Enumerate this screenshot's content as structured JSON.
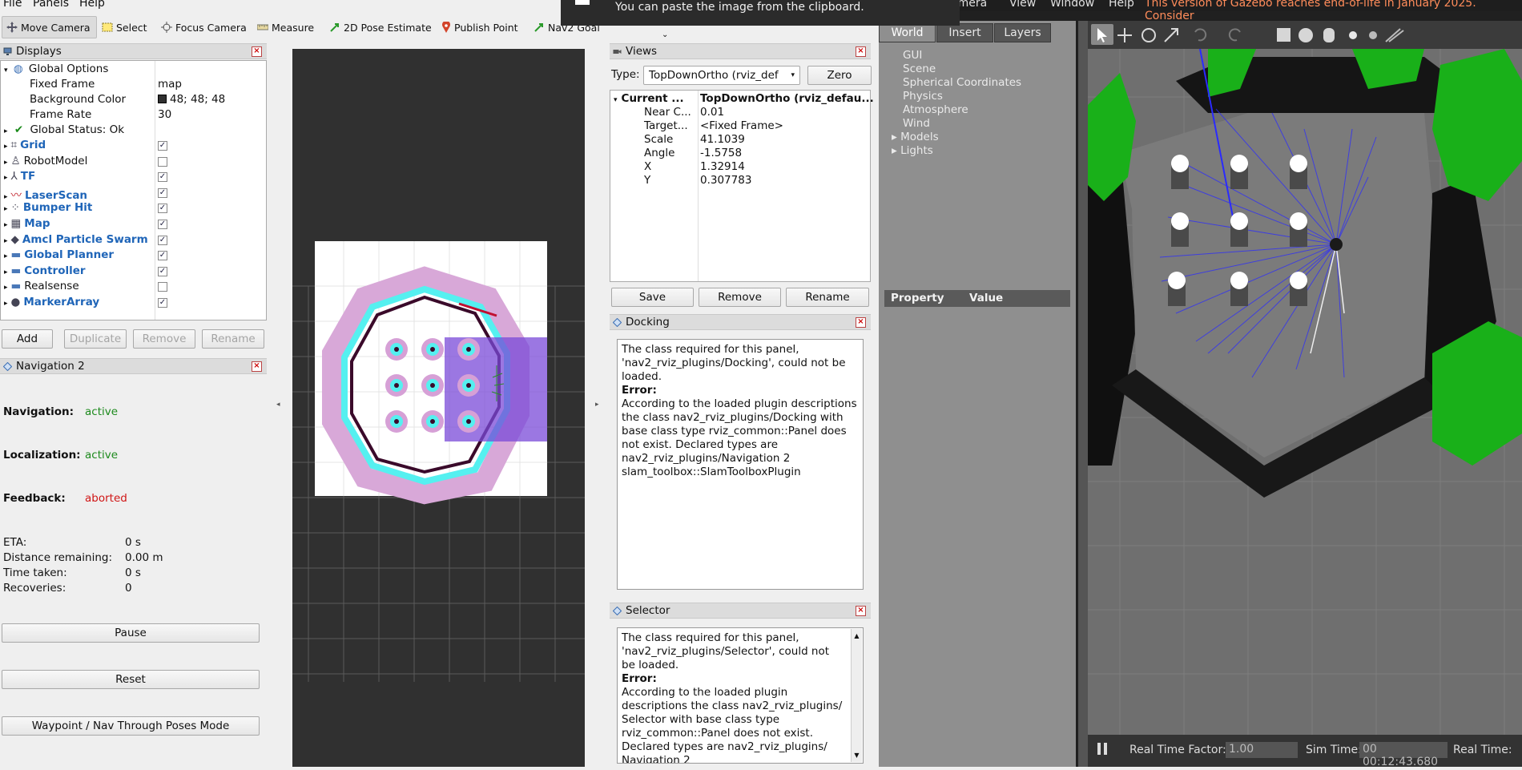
{
  "menubar": {
    "file": "File",
    "panels": "Panels",
    "help": "Help"
  },
  "toolbar": {
    "move_camera": "Move Camera",
    "select": "Select",
    "focus_camera": "Focus Camera",
    "measure": "Measure",
    "pose_estimate": "2D Pose Estimate",
    "publish_point": "Publish Point",
    "nav2_goal": "Nav2 Goal"
  },
  "notification": {
    "text": "You can paste the image from the clipboard."
  },
  "displays": {
    "title": "Displays",
    "global_options": "Global Options",
    "props": [
      {
        "name": "Fixed Frame",
        "value": "map"
      },
      {
        "name": "Background Color",
        "value": "48; 48; 48"
      },
      {
        "name": "Frame Rate",
        "value": "30"
      }
    ],
    "global_status": "Global Status: Ok",
    "items": [
      {
        "label": "Grid",
        "checked": true,
        "bold": true
      },
      {
        "label": "RobotModel",
        "checked": false,
        "bold": false
      },
      {
        "label": "TF",
        "checked": true,
        "bold": true
      },
      {
        "label": "LaserScan",
        "checked": true,
        "bold": true
      },
      {
        "label": "Bumper Hit",
        "checked": true,
        "bold": true
      },
      {
        "label": "Map",
        "checked": true,
        "bold": true
      },
      {
        "label": "Amcl Particle Swarm",
        "checked": true,
        "bold": true
      },
      {
        "label": "Global Planner",
        "checked": true,
        "bold": true
      },
      {
        "label": "Controller",
        "checked": true,
        "bold": true
      },
      {
        "label": "Realsense",
        "checked": false,
        "bold": false
      },
      {
        "label": "MarkerArray",
        "checked": true,
        "bold": true
      }
    ],
    "buttons": {
      "add": "Add",
      "duplicate": "Duplicate",
      "remove": "Remove",
      "rename": "Rename"
    }
  },
  "navigation": {
    "title": "Navigation 2",
    "navigation_label": "Navigation:",
    "navigation_value": "active",
    "localization_label": "Localization:",
    "localization_value": "active",
    "feedback_label": "Feedback:",
    "feedback_value": "aborted",
    "eta_label": "ETA:",
    "eta_value": "0 s",
    "distance_label": "Distance remaining:",
    "distance_value": "0.00 m",
    "time_label": "Time taken:",
    "time_value": "0 s",
    "recoveries_label": "Recoveries:",
    "recoveries_value": "0",
    "pause": "Pause",
    "reset": "Reset",
    "waypoint": "Waypoint / Nav Through Poses Mode"
  },
  "views": {
    "title": "Views",
    "type_label": "Type:",
    "type_value": "TopDownOrtho (rviz_def",
    "zero": "Zero",
    "current_label": "Current ...",
    "current_value": "TopDownOrtho (rviz_defau...",
    "props": [
      {
        "name": "Near C...",
        "value": "0.01"
      },
      {
        "name": "Target...",
        "value": "<Fixed Frame>"
      },
      {
        "name": "Scale",
        "value": "41.1039"
      },
      {
        "name": "Angle",
        "value": "-1.5758"
      },
      {
        "name": "X",
        "value": "1.32914"
      },
      {
        "name": "Y",
        "value": "0.307783"
      }
    ],
    "save": "Save",
    "remove": "Remove",
    "rename": "Rename"
  },
  "docking": {
    "title": "Docking",
    "line1": "The class required for this panel, 'nav2_rviz_plugins/Docking', could not be loaded.",
    "error_label": "Error:",
    "line2": "According to the loaded plugin descriptions the class nav2_rviz_plugins/Docking with base class type rviz_common::Panel does not exist. Declared types are nav2_rviz_plugins/Navigation 2 slam_toolbox::SlamToolboxPlugin"
  },
  "selector": {
    "title": "Selector",
    "line1": "The class required for this panel, 'nav2_rviz_plugins/Selector', could not be loaded.",
    "error_label": "Error:",
    "line2": "According to the loaded plugin descriptions the class nav2_rviz_plugins/ Selector with base class type rviz_common::Panel does not exist. Declared types are nav2_rviz_plugins/ Navigation 2"
  },
  "gazebo": {
    "menu": {
      "camera": "amera",
      "view": "View",
      "window": "Window",
      "help": "Help"
    },
    "eol_notice": "This version of Gazebo reaches end-of-life in January 2025. Consider",
    "tabs": [
      "World",
      "Insert",
      "Layers"
    ],
    "tree": [
      "GUI",
      "Scene",
      "Spherical Coordinates",
      "Physics",
      "Atmosphere",
      "Wind",
      "Models",
      "Lights"
    ],
    "property_header": "Property",
    "value_header": "Value",
    "real_time_factor_label": "Real Time Factor:",
    "real_time_factor_value": "1.00",
    "sim_time_label": "Sim Time:",
    "sim_time_value": "00 00:12:43.680",
    "real_time_label": "Real Time:"
  },
  "colors": {
    "accent_blue": "#1f65b8",
    "status_green": "#1d8a1d",
    "status_red": "#d01515",
    "gazebo_notice": "#ff8c5a"
  }
}
